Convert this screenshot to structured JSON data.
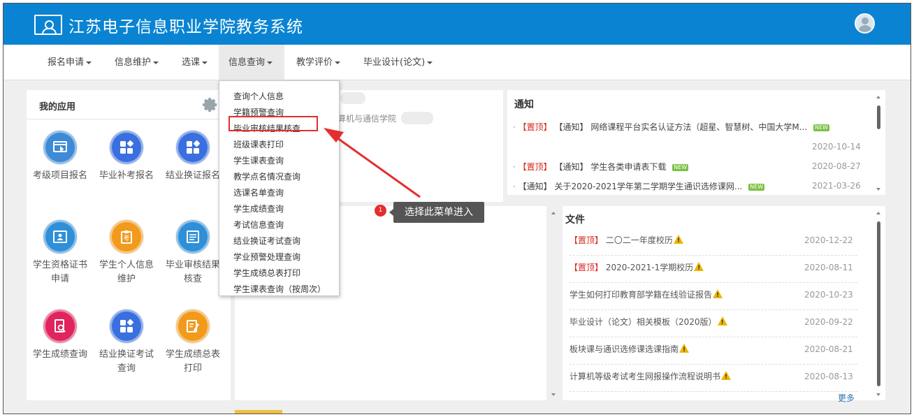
{
  "header": {
    "title": "江苏电子信息职业学院教务系统"
  },
  "nav": {
    "items": [
      {
        "label": "报名申请"
      },
      {
        "label": "信息维护"
      },
      {
        "label": "选课"
      },
      {
        "label": "信息查询"
      },
      {
        "label": "教学评价"
      },
      {
        "label": "毕业设计(论文)"
      }
    ],
    "active_index": 3
  },
  "dropdown": {
    "items": [
      {
        "label": "查询个人信息"
      },
      {
        "label": "学籍预警查询"
      },
      {
        "label": "毕业审核结果核查"
      },
      {
        "label": "班级课表打印"
      },
      {
        "label": "学生课表查询"
      },
      {
        "label": "教学点名情况查询"
      },
      {
        "label": "选课名单查询"
      },
      {
        "label": "学生成绩查询"
      },
      {
        "label": "考试信息查询"
      },
      {
        "label": "结业换证考试查询"
      },
      {
        "label": "学业预警处理查询"
      },
      {
        "label": "学生成绩总表打印"
      },
      {
        "label": "学生课表查询（按周次）"
      }
    ],
    "highlighted_index": 2
  },
  "callout": {
    "badge": "1",
    "text": "选择此菜单进入"
  },
  "apps": {
    "title": "我的应用",
    "items": [
      {
        "label": "考级项目报名",
        "color": "#3d8ad6",
        "icon": "window-cursor-icon"
      },
      {
        "label": "毕业补考报名",
        "color": "#3a6fe0",
        "icon": "grid-icon"
      },
      {
        "label": "结业换证报名",
        "color": "#3a6fe0",
        "icon": "grid-icon"
      },
      {
        "label": "学生资格证书申请",
        "color": "#2f8fd8",
        "icon": "id-card-icon"
      },
      {
        "label": "学生个人信息维护",
        "color": "#f29a1c",
        "icon": "clipboard-kao-icon"
      },
      {
        "label": "毕业审核结果核查",
        "color": "#2f8fd8",
        "icon": "document-list-icon"
      },
      {
        "label": "学生成绩查询",
        "color": "#e0245e",
        "icon": "search-doc-icon"
      },
      {
        "label": "结业换证考试查询",
        "color": "#3a6fe0",
        "icon": "grid-icon"
      },
      {
        "label": "学生成绩总表打印",
        "color": "#f29a1c",
        "icon": "edit-doc-icon"
      }
    ]
  },
  "profile": {
    "department": "算机与通信学院"
  },
  "notices": {
    "title": "通知",
    "items": [
      {
        "tags": [
          "【置顶】",
          "【通知】"
        ],
        "text": "网络课程平台实名认证方法（超星、智慧树、中国大学M...",
        "new": "NEW",
        "date": "2020-10-14"
      },
      {
        "tags": [
          "【置顶】",
          "【通知】"
        ],
        "text": "学生各类申请表下载",
        "new": "NEW",
        "date": "2020-08-27"
      },
      {
        "tags": [
          "【通知】"
        ],
        "text": "关于2020-2021学年第二学期学生通识选修课网...",
        "new": "NEW",
        "date": "2021-03-26"
      }
    ]
  },
  "files": {
    "title": "文件",
    "items": [
      {
        "tag": "【置顶】",
        "text": "二〇二一年度校历",
        "date": "2020-12-22"
      },
      {
        "tag": "【置顶】",
        "text": "2020-2021-1学期校历",
        "date": "2020-08-11"
      },
      {
        "tag": "",
        "text": "学生如何打印教育部学籍在线验证报告",
        "date": "2020-10-23"
      },
      {
        "tag": "",
        "text": "毕业设计（论文）相关模板（2020版）",
        "date": "2020-09-22"
      },
      {
        "tag": "",
        "text": "板块课与通识选修课选课指南",
        "date": "2020-08-21"
      },
      {
        "tag": "",
        "text": "计算机等级考试考生网报操作流程说明书",
        "date": "2020-08-13"
      }
    ],
    "more": "更多"
  }
}
